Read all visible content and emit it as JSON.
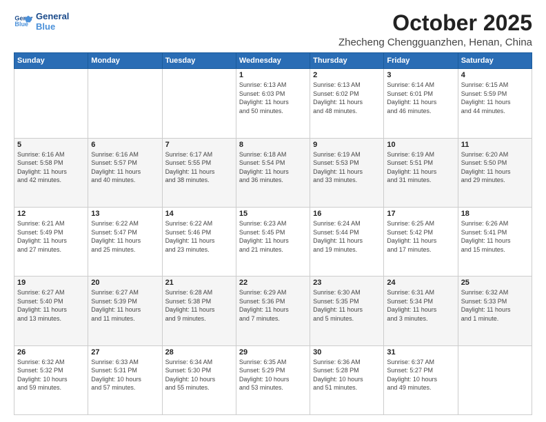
{
  "logo": {
    "line1": "General",
    "line2": "Blue"
  },
  "header": {
    "month": "October 2025",
    "location": "Zhecheng Chengguanzhen, Henan, China"
  },
  "days_of_week": [
    "Sunday",
    "Monday",
    "Tuesday",
    "Wednesday",
    "Thursday",
    "Friday",
    "Saturday"
  ],
  "weeks": [
    [
      {
        "day": "",
        "info": ""
      },
      {
        "day": "",
        "info": ""
      },
      {
        "day": "",
        "info": ""
      },
      {
        "day": "1",
        "info": "Sunrise: 6:13 AM\nSunset: 6:03 PM\nDaylight: 11 hours\nand 50 minutes."
      },
      {
        "day": "2",
        "info": "Sunrise: 6:13 AM\nSunset: 6:02 PM\nDaylight: 11 hours\nand 48 minutes."
      },
      {
        "day": "3",
        "info": "Sunrise: 6:14 AM\nSunset: 6:01 PM\nDaylight: 11 hours\nand 46 minutes."
      },
      {
        "day": "4",
        "info": "Sunrise: 6:15 AM\nSunset: 5:59 PM\nDaylight: 11 hours\nand 44 minutes."
      }
    ],
    [
      {
        "day": "5",
        "info": "Sunrise: 6:16 AM\nSunset: 5:58 PM\nDaylight: 11 hours\nand 42 minutes."
      },
      {
        "day": "6",
        "info": "Sunrise: 6:16 AM\nSunset: 5:57 PM\nDaylight: 11 hours\nand 40 minutes."
      },
      {
        "day": "7",
        "info": "Sunrise: 6:17 AM\nSunset: 5:55 PM\nDaylight: 11 hours\nand 38 minutes."
      },
      {
        "day": "8",
        "info": "Sunrise: 6:18 AM\nSunset: 5:54 PM\nDaylight: 11 hours\nand 36 minutes."
      },
      {
        "day": "9",
        "info": "Sunrise: 6:19 AM\nSunset: 5:53 PM\nDaylight: 11 hours\nand 33 minutes."
      },
      {
        "day": "10",
        "info": "Sunrise: 6:19 AM\nSunset: 5:51 PM\nDaylight: 11 hours\nand 31 minutes."
      },
      {
        "day": "11",
        "info": "Sunrise: 6:20 AM\nSunset: 5:50 PM\nDaylight: 11 hours\nand 29 minutes."
      }
    ],
    [
      {
        "day": "12",
        "info": "Sunrise: 6:21 AM\nSunset: 5:49 PM\nDaylight: 11 hours\nand 27 minutes."
      },
      {
        "day": "13",
        "info": "Sunrise: 6:22 AM\nSunset: 5:47 PM\nDaylight: 11 hours\nand 25 minutes."
      },
      {
        "day": "14",
        "info": "Sunrise: 6:22 AM\nSunset: 5:46 PM\nDaylight: 11 hours\nand 23 minutes."
      },
      {
        "day": "15",
        "info": "Sunrise: 6:23 AM\nSunset: 5:45 PM\nDaylight: 11 hours\nand 21 minutes."
      },
      {
        "day": "16",
        "info": "Sunrise: 6:24 AM\nSunset: 5:44 PM\nDaylight: 11 hours\nand 19 minutes."
      },
      {
        "day": "17",
        "info": "Sunrise: 6:25 AM\nSunset: 5:42 PM\nDaylight: 11 hours\nand 17 minutes."
      },
      {
        "day": "18",
        "info": "Sunrise: 6:26 AM\nSunset: 5:41 PM\nDaylight: 11 hours\nand 15 minutes."
      }
    ],
    [
      {
        "day": "19",
        "info": "Sunrise: 6:27 AM\nSunset: 5:40 PM\nDaylight: 11 hours\nand 13 minutes."
      },
      {
        "day": "20",
        "info": "Sunrise: 6:27 AM\nSunset: 5:39 PM\nDaylight: 11 hours\nand 11 minutes."
      },
      {
        "day": "21",
        "info": "Sunrise: 6:28 AM\nSunset: 5:38 PM\nDaylight: 11 hours\nand 9 minutes."
      },
      {
        "day": "22",
        "info": "Sunrise: 6:29 AM\nSunset: 5:36 PM\nDaylight: 11 hours\nand 7 minutes."
      },
      {
        "day": "23",
        "info": "Sunrise: 6:30 AM\nSunset: 5:35 PM\nDaylight: 11 hours\nand 5 minutes."
      },
      {
        "day": "24",
        "info": "Sunrise: 6:31 AM\nSunset: 5:34 PM\nDaylight: 11 hours\nand 3 minutes."
      },
      {
        "day": "25",
        "info": "Sunrise: 6:32 AM\nSunset: 5:33 PM\nDaylight: 11 hours\nand 1 minute."
      }
    ],
    [
      {
        "day": "26",
        "info": "Sunrise: 6:32 AM\nSunset: 5:32 PM\nDaylight: 10 hours\nand 59 minutes."
      },
      {
        "day": "27",
        "info": "Sunrise: 6:33 AM\nSunset: 5:31 PM\nDaylight: 10 hours\nand 57 minutes."
      },
      {
        "day": "28",
        "info": "Sunrise: 6:34 AM\nSunset: 5:30 PM\nDaylight: 10 hours\nand 55 minutes."
      },
      {
        "day": "29",
        "info": "Sunrise: 6:35 AM\nSunset: 5:29 PM\nDaylight: 10 hours\nand 53 minutes."
      },
      {
        "day": "30",
        "info": "Sunrise: 6:36 AM\nSunset: 5:28 PM\nDaylight: 10 hours\nand 51 minutes."
      },
      {
        "day": "31",
        "info": "Sunrise: 6:37 AM\nSunset: 5:27 PM\nDaylight: 10 hours\nand 49 minutes."
      },
      {
        "day": "",
        "info": ""
      }
    ]
  ]
}
